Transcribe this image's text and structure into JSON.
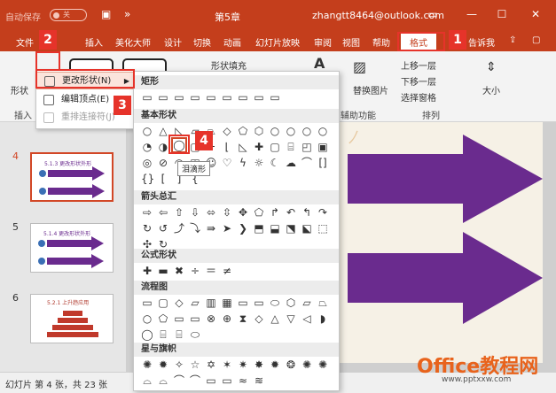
{
  "titlebar": {
    "autosave_label": "自动保存",
    "autosave_state": "关",
    "doc_title": "第5章",
    "account": "zhangtt8464@outlook.com"
  },
  "tabs": [
    "文件",
    "开始",
    "插入",
    "美化大师",
    "设计",
    "切换",
    "动画",
    "幻灯片放映",
    "审阅",
    "视图",
    "帮助",
    "格式",
    "告诉我"
  ],
  "active_tab": "格式",
  "ribbon": {
    "shape_label": "形状",
    "insert_group": "插入",
    "shape_fill": "形状填充",
    "replace_image": "替换图片",
    "aux_function": "辅助功能",
    "bring_forward": "上移一层",
    "send_backward": "下移一层",
    "selection_pane": "选择窗格",
    "arrange_group": "排列",
    "size_label": "大小"
  },
  "context_menu": {
    "change_shape": "更改形状(N)",
    "edit_points": "编辑顶点(E)",
    "reroute": "重排连接符(J)"
  },
  "gallery": {
    "sections": [
      "矩形",
      "基本形状",
      "箭头总汇",
      "公式形状",
      "流程图",
      "星与旗帜"
    ],
    "tooltip": "泪滴形"
  },
  "slides": [
    {
      "num": "4",
      "title": "5.1.3 更改形状外形"
    },
    {
      "num": "5",
      "title": "5.1.4 更改形状外形"
    },
    {
      "num": "6",
      "title": "5.2.1 上升趋应用"
    }
  ],
  "statusbar": {
    "text": "幻灯片 第 4 张，共 23 张"
  },
  "watermark": {
    "logo": "Office教程网",
    "url": "www.pptxxw.com"
  },
  "badges": [
    "1",
    "2",
    "3",
    "4"
  ],
  "colors": {
    "accent": "#c43e1c",
    "callout": "#e6332a",
    "arrow": "#6a2b8e"
  }
}
